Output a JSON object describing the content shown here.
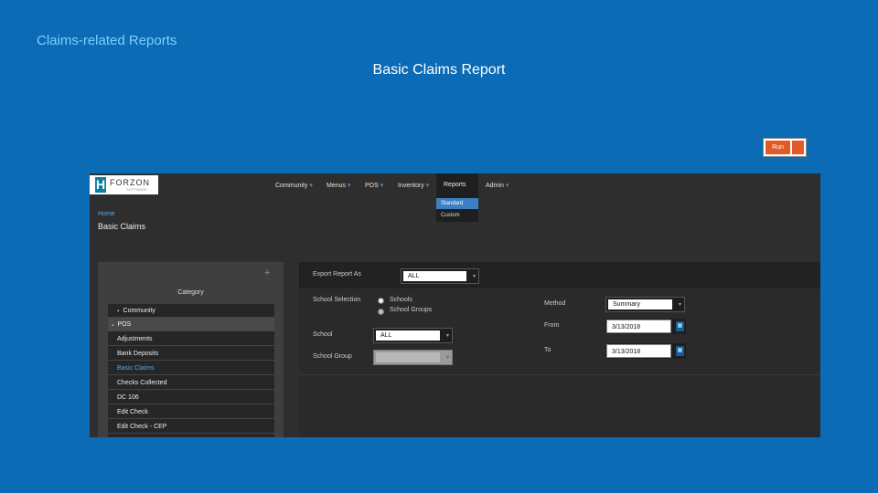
{
  "slide": {
    "subtitle": "Claims-related Reports",
    "title": "Basic Claims Report",
    "run_label": "Run"
  },
  "app": {
    "logo": {
      "letter": "H",
      "brand": "FORZON",
      "tagline": "SOFTWARE"
    },
    "nav": [
      {
        "label": "Community"
      },
      {
        "label": "Menus"
      },
      {
        "label": "POS"
      },
      {
        "label": "Inventory"
      },
      {
        "label": "Reports"
      },
      {
        "label": "Admin"
      }
    ],
    "reports_menu": [
      "Standard",
      "Custom"
    ],
    "breadcrumb": "Home",
    "page_title": "Basic Claims",
    "category": {
      "label": "Category",
      "items": [
        {
          "label": "Community"
        },
        {
          "label": "POS"
        },
        {
          "label": "Adjustments"
        },
        {
          "label": "Bank Deposits"
        },
        {
          "label": "Basic Claims"
        },
        {
          "label": "Checks Collected"
        },
        {
          "label": "DC 106"
        },
        {
          "label": "Edit Check"
        },
        {
          "label": "Edit Check - CEP"
        }
      ]
    },
    "form": {
      "export_label": "Export Report As",
      "export_value": "ALL",
      "school_selection_label": "School Selection",
      "radio_schools": "Schools",
      "radio_school_groups": "School Groups",
      "school_label": "School",
      "school_value": "ALL",
      "school_group_label": "School Group",
      "school_group_value": "",
      "method_label": "Method",
      "method_value": "Summary",
      "from_label": "From",
      "from_value": "3/13/2018",
      "to_label": "To",
      "to_value": "3/13/2018"
    }
  }
}
